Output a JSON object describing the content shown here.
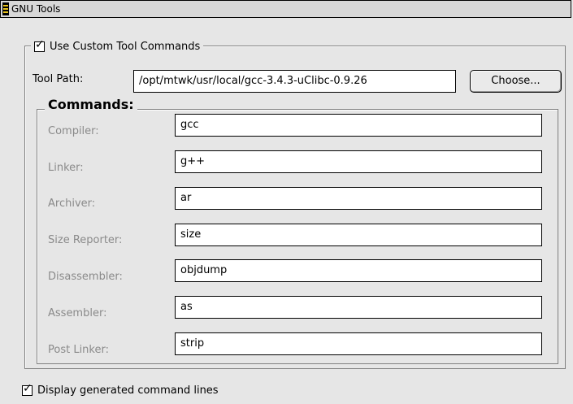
{
  "window": {
    "title": "GNU Tools"
  },
  "use_custom": {
    "label": "Use Custom Tool Commands",
    "checked": true
  },
  "tool_path": {
    "label": "Tool Path:",
    "value": "/opt/mtwk/usr/local/gcc-3.4.3-uClibc-0.9.26",
    "choose_label": "Choose..."
  },
  "commands": {
    "heading": "Commands:",
    "rows": [
      {
        "label": "Compiler:",
        "value": "gcc"
      },
      {
        "label": "Linker:",
        "value": "g++"
      },
      {
        "label": "Archiver:",
        "value": "ar"
      },
      {
        "label": "Size Reporter:",
        "value": "size"
      },
      {
        "label": "Disassembler:",
        "value": "objdump"
      },
      {
        "label": "Assembler:",
        "value": "as"
      },
      {
        "label": "Post Linker:",
        "value": "strip"
      }
    ]
  },
  "display_lines": {
    "label": "Display generated command lines",
    "checked": true
  }
}
